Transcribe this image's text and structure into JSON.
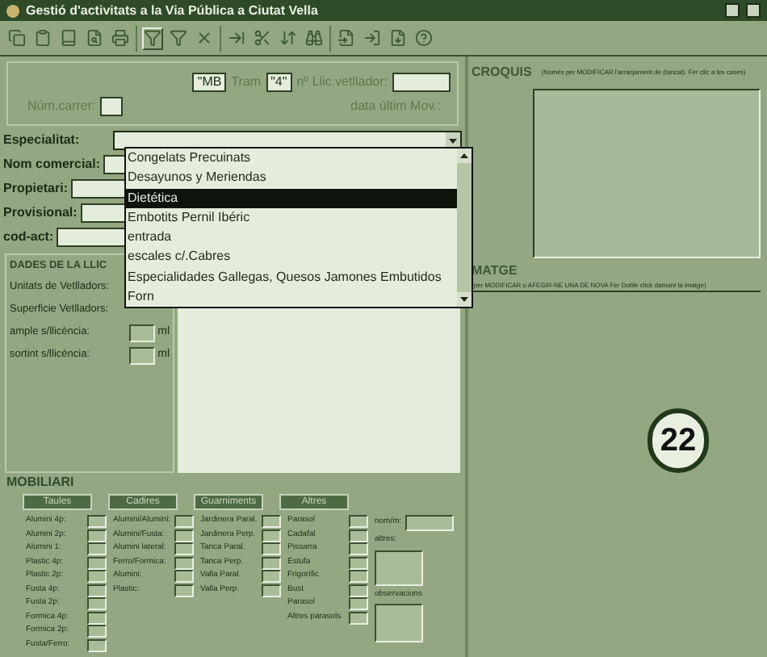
{
  "window": {
    "title": "Gestió d'activitats a la Via Pública a Ciutat Vella"
  },
  "header": {
    "street_code": "\"MB",
    "tram_label": "Tram",
    "tram": "\"4\"",
    "licence_label": "nº Llic.vetllador:",
    "street_number_label": "Núm.carrer:",
    "last_move_label": "data últim Mov.:"
  },
  "fields": [
    {
      "label": "Especialitat:"
    },
    {
      "label": "Nom comercial:"
    },
    {
      "label": "Propietari:"
    },
    {
      "label": "Provisional:"
    },
    {
      "label": "cod-act:"
    }
  ],
  "dropdown": {
    "items": [
      {
        "label": "Congelats Precuinats",
        "selected": false
      },
      {
        "label": "Desayunos y Meriendas",
        "selected": false
      },
      {
        "label": "Dietética",
        "selected": true
      },
      {
        "label": "Embotits Pernil Ibéric",
        "selected": false
      },
      {
        "label": "entrada",
        "selected": false
      },
      {
        "label": "escales c/.Cabres",
        "selected": false
      },
      {
        "label": "Especialidades Gallegas, Quesos Jamones Embutidos",
        "selected": false
      },
      {
        "label": "Forn",
        "selected": false
      }
    ]
  },
  "licence": {
    "title": "DADES DE LA LLIC",
    "rows": [
      {
        "label": "Unitats de Vetlladors:"
      },
      {
        "label": "Superficie Vetlladors:"
      },
      {
        "label": "ample s/llicència:",
        "unit": "ml"
      },
      {
        "label": "sortint s/llicència:",
        "unit": "ml"
      }
    ]
  },
  "sketch": {
    "title": "CROQUIS",
    "hint": "(Només per MODIFICAR l'arranjament de (tancat). Fer clic a les cases)"
  },
  "image": {
    "title": "MATGE",
    "hint": "(per MODIFICAR o AFEGIR-NE UNA DE NOVA Fer Doble click damunt la imatge)",
    "badge": "22"
  },
  "furniture": {
    "title": "MOBILIARI",
    "tabs": [
      "Taules",
      "Cadires",
      "Guarniments",
      "Altres"
    ],
    "columns": [
      [
        "Alumini 4p:",
        "Alumini 2p:",
        "Alumini 1:",
        "Plastic 4p:",
        "Plastic 2p:",
        "Fusta 4p:",
        "Fusta 2p:",
        "Formica 4p:",
        "Formica 2p:",
        "Fusta/Ferro:"
      ],
      [
        "Alumini/Alumini:",
        "Alumini/Fusta:",
        "Alumini lateral:",
        "Ferro/Formica:",
        "Alumini:",
        "Plastic:"
      ],
      [
        "Jardinera Paral.",
        "Jardinera Perp.",
        "Tanca Paral.",
        "Tanca Perp.",
        "Valla Paral.",
        "Valla Perp."
      ],
      [
        "Parasol",
        "Cadafal",
        "Pissarra",
        "Estufa",
        "Frigorífic",
        "Bust",
        "Parasol",
        "Altres parasols"
      ]
    ],
    "side": {
      "name_label": "nom/m:",
      "other_label": "altres:",
      "notes_label": "observacions"
    }
  }
}
